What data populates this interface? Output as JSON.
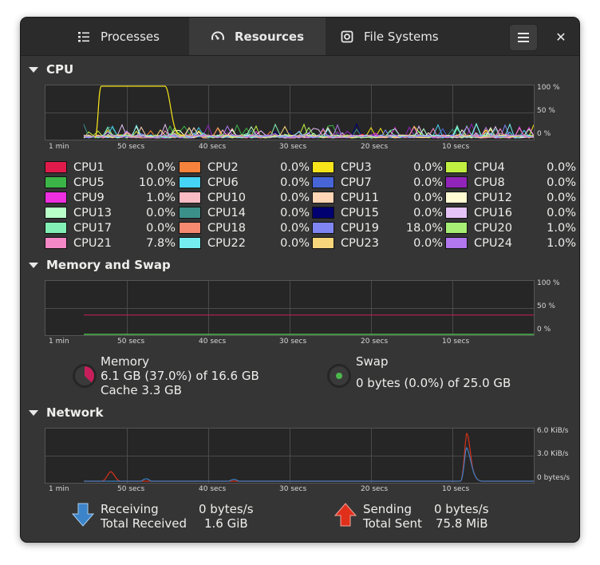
{
  "header": {
    "tabs": [
      {
        "label": "Processes",
        "icon": "list-icon"
      },
      {
        "label": "Resources",
        "icon": "speedometer-icon",
        "active": true
      },
      {
        "label": "File Systems",
        "icon": "disk-icon"
      }
    ],
    "menu_icon": "hamburger-menu-icon",
    "close_label": "✕"
  },
  "cpu": {
    "title": "CPU",
    "y_labels": [
      "100 %",
      "50 %",
      "0 %"
    ],
    "x_labels": [
      "1 min",
      "50 secs",
      "40 secs",
      "30 secs",
      "20 secs",
      "10 secs"
    ],
    "cores": [
      {
        "name": "CPU1",
        "value": "0.0%",
        "color": "#e01b4b"
      },
      {
        "name": "CPU2",
        "value": "0.0%",
        "color": "#f6823b"
      },
      {
        "name": "CPU3",
        "value": "0.0%",
        "color": "#f8e41b"
      },
      {
        "name": "CPU4",
        "value": "0.0%",
        "color": "#c0ef42"
      },
      {
        "name": "CPU5",
        "value": "10.0%",
        "color": "#3cb548"
      },
      {
        "name": "CPU6",
        "value": "0.0%",
        "color": "#45d4f5"
      },
      {
        "name": "CPU7",
        "value": "0.0%",
        "color": "#4765d6"
      },
      {
        "name": "CPU8",
        "value": "0.0%",
        "color": "#9124b9"
      },
      {
        "name": "CPU9",
        "value": "1.0%",
        "color": "#ee2fe0"
      },
      {
        "name": "CPU10",
        "value": "0.0%",
        "color": "#f9bcc5"
      },
      {
        "name": "CPU11",
        "value": "0.0%",
        "color": "#ffd6b5"
      },
      {
        "name": "CPU12",
        "value": "0.0%",
        "color": "#fffbd3"
      },
      {
        "name": "CPU13",
        "value": "0.0%",
        "color": "#b9ffc8"
      },
      {
        "name": "CPU14",
        "value": "0.0%",
        "color": "#3c908a"
      },
      {
        "name": "CPU15",
        "value": "0.0%",
        "color": "#000070"
      },
      {
        "name": "CPU16",
        "value": "0.0%",
        "color": "#e6c3f6"
      },
      {
        "name": "CPU17",
        "value": "0.0%",
        "color": "#82f0b5"
      },
      {
        "name": "CPU18",
        "value": "0.0%",
        "color": "#f58a70"
      },
      {
        "name": "CPU19",
        "value": "18.0%",
        "color": "#7f86f3"
      },
      {
        "name": "CPU20",
        "value": "1.0%",
        "color": "#a6ee74"
      },
      {
        "name": "CPU21",
        "value": "7.8%",
        "color": "#f487c5"
      },
      {
        "name": "CPU22",
        "value": "0.0%",
        "color": "#75edf0"
      },
      {
        "name": "CPU23",
        "value": "0.0%",
        "color": "#f7d67b"
      },
      {
        "name": "CPU24",
        "value": "1.0%",
        "color": "#b277ee"
      }
    ]
  },
  "memory": {
    "title": "Memory and Swap",
    "y_labels": [
      "100 %",
      "50 %",
      "0 %"
    ],
    "x_labels": [
      "1 min",
      "50 secs",
      "40 secs",
      "30 secs",
      "20 secs",
      "10 secs"
    ],
    "memory_label": "Memory",
    "memory_value": "6.1 GB (37.0%) of 16.6 GB",
    "cache_value": "Cache 3.3 GB",
    "memory_fraction": 0.37,
    "memory_color": "#c61e5b",
    "swap_label": "Swap",
    "swap_value": "0 bytes (0.0%) of 25.0 GB",
    "swap_fraction": 0.0,
    "swap_color": "#4cb84c"
  },
  "network": {
    "title": "Network",
    "y_labels": [
      "6.0 KiB/s",
      "3.0 KiB/s",
      "0 bytes/s"
    ],
    "x_labels": [
      "1 min",
      "50 secs",
      "40 secs",
      "30 secs",
      "20 secs",
      "10 secs"
    ],
    "receiving_label": "Receiving",
    "receiving_value": "0 bytes/s",
    "total_received_label": "Total Received",
    "total_received_value": "1.6 GiB",
    "sending_label": "Sending",
    "sending_value": "0 bytes/s",
    "total_sent_label": "Total Sent",
    "total_sent_value": "75.8 MiB",
    "receive_color": "#3c7fc4",
    "send_color": "#d7311b"
  }
}
